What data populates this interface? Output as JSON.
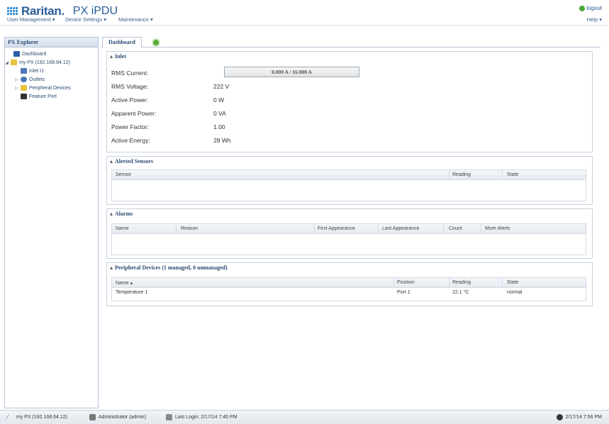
{
  "header": {
    "brand": "Raritan.",
    "product": "PX iPDU",
    "logout_label": "logout",
    "help_label": "Help ▾"
  },
  "menubar": {
    "items": [
      {
        "label": "User Management ▾"
      },
      {
        "label": "Device Settings ▾"
      },
      {
        "label": "Maintenance ▾"
      }
    ]
  },
  "sidebar": {
    "title": "PX Explorer",
    "items": [
      {
        "label": "Dashboard",
        "icon": "dashboard-icon",
        "color": "#2b5da8"
      },
      {
        "label": "my PX (192.168.64.12)",
        "icon": "pdu-icon",
        "color": "#e8c23a"
      },
      {
        "label": "Inlet I1",
        "icon": "plug-icon",
        "color": "#4a78b8"
      },
      {
        "label": "Outlets",
        "icon": "outlets-icon",
        "color": "#4a78b8"
      },
      {
        "label": "Peripheral Devices",
        "icon": "folder-icon",
        "color": "#e8c23a"
      },
      {
        "label": "Feature Port",
        "icon": "port-icon",
        "color": "#333333"
      }
    ]
  },
  "tabs": [
    {
      "label": "Dashboard"
    }
  ],
  "inlet": {
    "title": "Inlet",
    "rows": [
      {
        "label": "RMS Current:",
        "value": "0.000 A / 16.000 A"
      },
      {
        "label": "RMS Voltage:",
        "value": "222 V"
      },
      {
        "label": "Active Power:",
        "value": "0 W"
      },
      {
        "label": "Apparent Power:",
        "value": "0 VA"
      },
      {
        "label": "Power Factor:",
        "value": "1.00"
      },
      {
        "label": "Active Energy:",
        "value": "28 Wh"
      }
    ]
  },
  "alerted_sensors": {
    "title": "Alerted Sensors",
    "columns": [
      "Sensor",
      "Reading",
      "State"
    ]
  },
  "alarms": {
    "title": "Alarms",
    "columns": [
      "Name",
      "Reason",
      "First Appearance",
      "Last Appearance",
      "Count",
      "More Alerts"
    ]
  },
  "peripheral_devices": {
    "title": "Peripheral Devices (1 managed, 0 unmanaged)",
    "columns": [
      "Name ▴",
      "Position",
      "Reading",
      "State"
    ],
    "rows": [
      {
        "name": "Temperature 1",
        "position": "Port 1",
        "reading": "22.1 °C",
        "state": "normal"
      }
    ]
  },
  "statusbar": {
    "device": "my PX (192.168.64.12)",
    "user": "Administrator (admin)",
    "last_login": "Last Login: 2/17/14 7:40 PM",
    "clock": "2/17/14 7:56 PM"
  },
  "colors": {
    "brand": "#2a5d9a",
    "accent": "#3b8fd4",
    "add_tab": "#5aab3a"
  }
}
